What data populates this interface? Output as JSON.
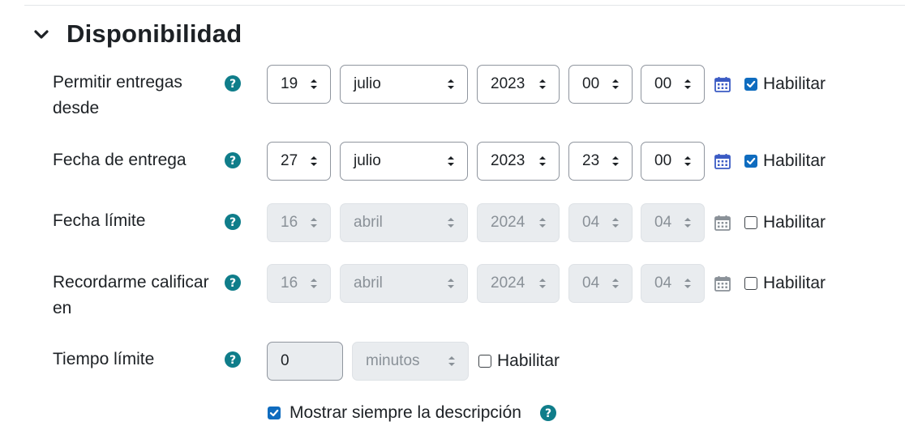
{
  "section": {
    "title": "Disponibilidad",
    "collapse_icon": "chevron-down-icon"
  },
  "rows": [
    {
      "label": "Permitir entregas desde",
      "day": "19",
      "month": "julio",
      "year": "2023",
      "hour": "00",
      "minute": "00",
      "enable_label": "Habilitar",
      "enabled": true
    },
    {
      "label": "Fecha de entrega",
      "day": "27",
      "month": "julio",
      "year": "2023",
      "hour": "23",
      "minute": "00",
      "enable_label": "Habilitar",
      "enabled": true
    },
    {
      "label": "Fecha límite",
      "day": "16",
      "month": "abril",
      "year": "2024",
      "hour": "04",
      "minute": "04",
      "enable_label": "Habilitar",
      "enabled": false
    },
    {
      "label": "Recordarme calificar en",
      "day": "16",
      "month": "abril",
      "year": "2024",
      "hour": "04",
      "minute": "04",
      "enable_label": "Habilitar",
      "enabled": false
    }
  ],
  "time_limit": {
    "label": "Tiempo límite",
    "value": "0",
    "unit": "minutos",
    "enable_label": "Habilitar",
    "enabled": false
  },
  "always_show_description": {
    "label": "Mostrar siempre la descripción",
    "checked": true
  },
  "colors": {
    "accent": "#0f6cbf",
    "help_icon": "#0f7d8a",
    "disabled_bg": "#e9ecef"
  },
  "icons": {
    "help": "question-circle-icon",
    "calendar": "calendar-icon",
    "select_arrows": "sort-arrows-icon"
  }
}
